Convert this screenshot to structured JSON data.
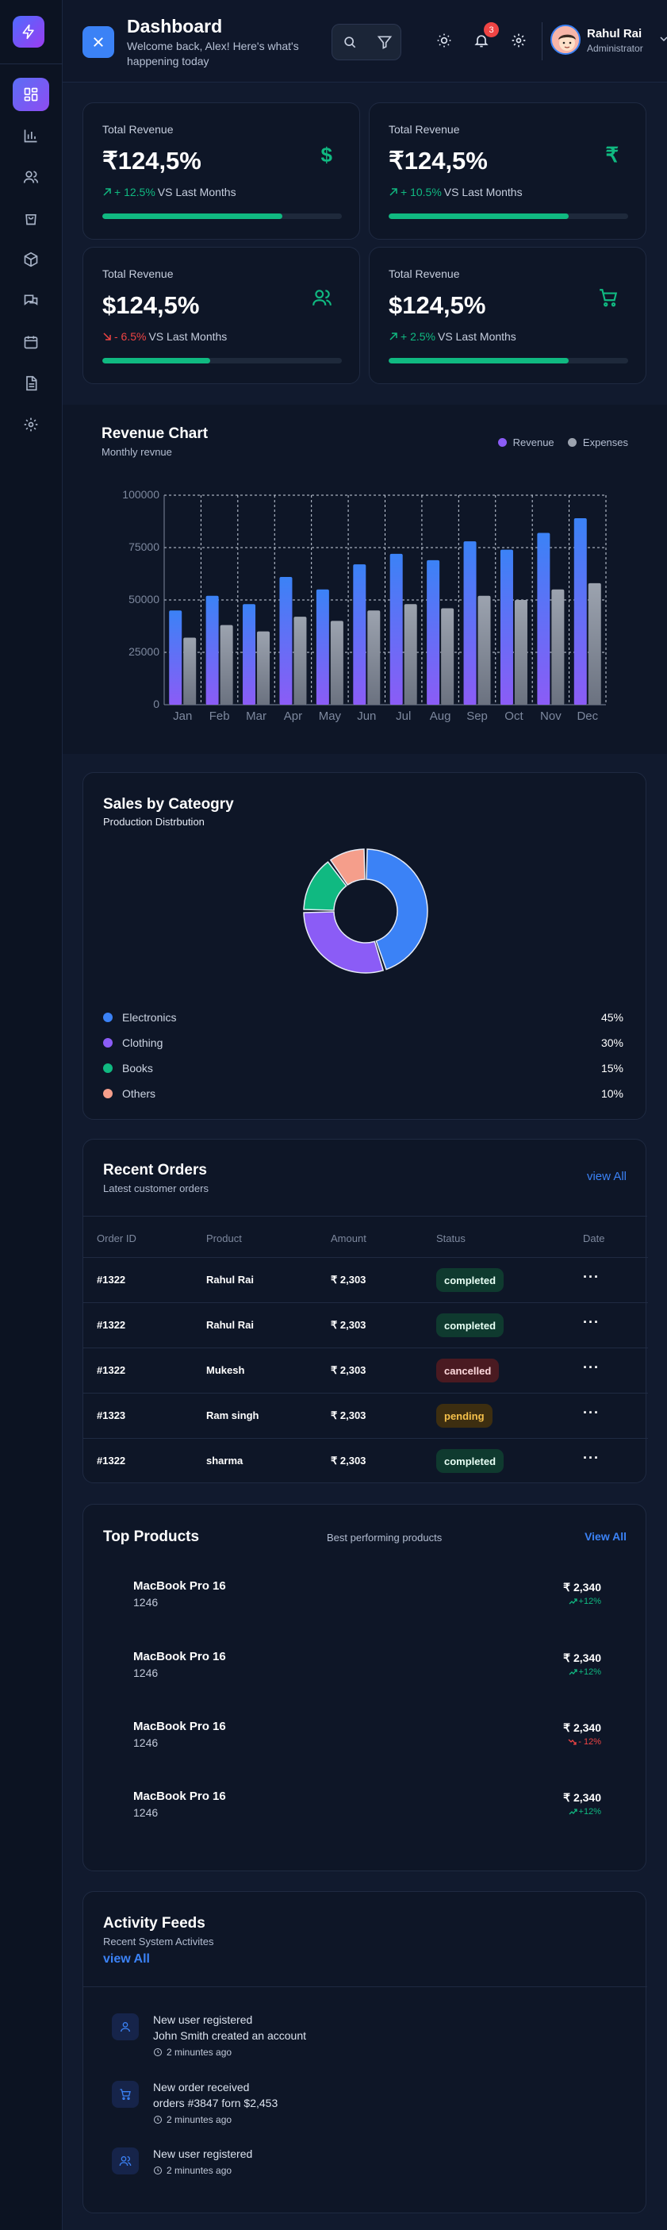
{
  "header": {
    "title": "Dashboard",
    "subtitle": "Welcome back, Alex! Here's what's happening today",
    "notification_count": "3",
    "user_name": "Rahul Rai",
    "user_role": "Administrator"
  },
  "sidebar": {
    "items": [
      {
        "icon": "dashboard-grid-icon",
        "active": true
      },
      {
        "icon": "bar-chart-icon",
        "active": false
      },
      {
        "icon": "users-icon",
        "active": false
      },
      {
        "icon": "shopping-bag-icon",
        "active": false
      },
      {
        "icon": "box-icon",
        "active": false
      },
      {
        "icon": "messages-icon",
        "active": false
      },
      {
        "icon": "calendar-icon",
        "active": false
      },
      {
        "icon": "document-icon",
        "active": false
      },
      {
        "icon": "settings-icon",
        "active": false
      }
    ]
  },
  "stats": [
    {
      "label": "Total Revenue",
      "value": "₹124,5%",
      "icon": "dollar-icon",
      "change": "+ 12.5%",
      "change_dir": "up",
      "compare": "VS Last Months",
      "progress": 0.75
    },
    {
      "label": "Total Revenue",
      "value": "₹124,5%",
      "icon": "rupee-icon",
      "change": "+ 10.5%",
      "change_dir": "up",
      "compare": "VS Last Months",
      "progress": 0.75
    },
    {
      "label": "Total Revenue",
      "value": "$124,5%",
      "icon": "users-icon",
      "change": "- 6.5%",
      "change_dir": "down",
      "compare": "VS Last Months",
      "progress": 0.45
    },
    {
      "label": "Total Revenue",
      "value": "$124,5%",
      "icon": "cart-icon",
      "change": "+ 2.5%",
      "change_dir": "up",
      "compare": "VS Last Months",
      "progress": 0.75
    }
  ],
  "revenue_chart": {
    "title": "Revenue Chart",
    "subtitle": "Monthly revnue",
    "legend": [
      "Revenue",
      "Expenses"
    ]
  },
  "chart_data": [
    {
      "type": "bar",
      "title": "Revenue Chart",
      "subtitle": "Monthly revnue",
      "categories": [
        "Jan",
        "Feb",
        "Mar",
        "Apr",
        "May",
        "Jun",
        "Jul",
        "Aug",
        "Sep",
        "Oct",
        "Nov",
        "Dec"
      ],
      "series": [
        {
          "name": "Revenue",
          "values": [
            45000,
            52000,
            48000,
            61000,
            55000,
            67000,
            72000,
            69000,
            78000,
            74000,
            82000,
            89000
          ],
          "color": "#3b82f6"
        },
        {
          "name": "Expenses",
          "values": [
            32000,
            38000,
            35000,
            42000,
            40000,
            45000,
            48000,
            46000,
            52000,
            50000,
            55000,
            58000
          ],
          "color": "#9ca3af"
        }
      ],
      "yticks": [
        "0",
        "25000",
        "50000",
        "75000",
        "100000"
      ],
      "ylim": [
        0,
        100000
      ],
      "grid": true,
      "legend_position": "top-right"
    },
    {
      "type": "pie",
      "title": "Sales by Cateogry",
      "subtitle": "Production Distrbution",
      "categories": [
        "Electronics",
        "Clothing",
        "Books",
        "Others"
      ],
      "values": [
        45,
        30,
        15,
        10
      ],
      "labels": [
        "45%",
        "30%",
        "15%",
        "10%"
      ],
      "colors": [
        "#3b82f6",
        "#8b5cf6",
        "#10b981",
        "#f59e8b"
      ]
    }
  ],
  "sales": {
    "title": "Sales by Cateogry",
    "subtitle": "Production Distrbution",
    "items": [
      {
        "name": "Electronics",
        "pct": "45%",
        "color": "#3b82f6"
      },
      {
        "name": "Clothing",
        "pct": "30%",
        "color": "#8b5cf6"
      },
      {
        "name": "Books",
        "pct": "15%",
        "color": "#10b981"
      },
      {
        "name": "Others",
        "pct": "10%",
        "color": "#f59e8b"
      }
    ]
  },
  "orders": {
    "title": "Recent Orders",
    "subtitle": "Latest customer orders",
    "view_all": "view All",
    "columns": [
      "Order ID",
      "Product",
      "Amount",
      "Status",
      "Date"
    ],
    "rows": [
      {
        "id": "#1322",
        "product": "Rahul Rai",
        "amount": "₹ 2,303",
        "status": "completed"
      },
      {
        "id": "#1322",
        "product": "Rahul Rai",
        "amount": "₹ 2,303",
        "status": "completed"
      },
      {
        "id": "#1322",
        "product": "Mukesh",
        "amount": "₹ 2,303",
        "status": "cancelled"
      },
      {
        "id": "#1323",
        "product": "Ram singh",
        "amount": "₹ 2,303",
        "status": "pending"
      },
      {
        "id": "#1322",
        "product": "sharma",
        "amount": "₹ 2,303",
        "status": "completed"
      }
    ]
  },
  "products": {
    "title": "Top Products",
    "subtitle": "Best performing products",
    "view_all": "View All",
    "items": [
      {
        "name": "MacBook Pro 16",
        "count": "1246",
        "price": "₹ 2,340",
        "change": "+12%",
        "dir": "up"
      },
      {
        "name": "MacBook Pro 16",
        "count": "1246",
        "price": "₹ 2,340",
        "change": "+12%",
        "dir": "up"
      },
      {
        "name": "MacBook Pro 16",
        "count": "1246",
        "price": "₹ 2,340",
        "change": "- 12%",
        "dir": "down"
      },
      {
        "name": "MacBook Pro 16",
        "count": "1246",
        "price": "₹ 2,340",
        "change": "+12%",
        "dir": "up"
      }
    ]
  },
  "activity": {
    "title": "Activity Feeds",
    "subtitle": "Recent System Activites",
    "view_all": "view All",
    "items": [
      {
        "icon": "user-icon",
        "title": "New user registered",
        "desc": "John Smith created an account",
        "time": "2 minuntes ago"
      },
      {
        "icon": "cart-icon",
        "title": "New order received",
        "desc": "orders #3847 forn $2,453",
        "time": "2 minuntes ago"
      },
      {
        "icon": "users-icon",
        "title": "New user registered",
        "desc": "",
        "time": "2 minuntes ago"
      }
    ]
  }
}
